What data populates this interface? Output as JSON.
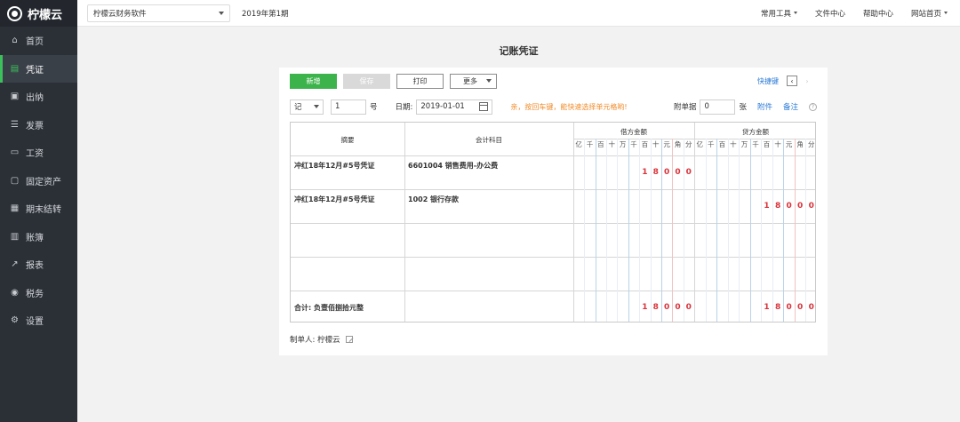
{
  "brand": {
    "name": "柠檬云"
  },
  "sidebar": {
    "items": [
      {
        "label": "首页",
        "icon": "⌂"
      },
      {
        "label": "凭证",
        "icon": "▤"
      },
      {
        "label": "出纳",
        "icon": "▣"
      },
      {
        "label": "发票",
        "icon": "☰"
      },
      {
        "label": "工资",
        "icon": "▭"
      },
      {
        "label": "固定资产",
        "icon": "▢"
      },
      {
        "label": "期末结转",
        "icon": "▦"
      },
      {
        "label": "账簿",
        "icon": "▥"
      },
      {
        "label": "报表",
        "icon": "↗"
      },
      {
        "label": "税务",
        "icon": "◉"
      },
      {
        "label": "设置",
        "icon": "⚙"
      }
    ],
    "active_index": 1
  },
  "topbar": {
    "company": "柠檬云财务软件",
    "period": "2019年第1期",
    "tools": "常用工具",
    "files": "文件中心",
    "help": "帮助中心",
    "site": "网站首页"
  },
  "page": {
    "title": "记账凭证"
  },
  "toolbar": {
    "new": "新增",
    "save": "保存",
    "print": "打印",
    "more": "更多",
    "shortcut": "快捷键",
    "prev": "‹",
    "next": "›"
  },
  "meta": {
    "word": "记",
    "number": "1",
    "hao": "号",
    "date_label": "日期:",
    "date": "2019-01-01",
    "hint": "亲，按回车键，能快速选择单元格哟!",
    "attach_label": "附单据",
    "attach_count": "0",
    "zhang": "张",
    "attachment": "附件",
    "note": "备注",
    "help": "?"
  },
  "table": {
    "summary_header": "摘要",
    "account_header": "会计科目",
    "debit_header": "借方金额",
    "credit_header": "贷方金额",
    "digit_units": [
      "亿",
      "千",
      "百",
      "十",
      "万",
      "千",
      "百",
      "十",
      "元",
      "角",
      "分"
    ],
    "rows": [
      {
        "summary": "冲红18年12月#5号凭证",
        "account": "6601004 销售费用-办公费",
        "debit": [
          "1",
          "8",
          "0",
          "0",
          "0"
        ],
        "credit": []
      },
      {
        "summary": "冲红18年12月#5号凭证",
        "account": "1002 银行存款",
        "debit": [],
        "credit": [
          "1",
          "8",
          "0",
          "0",
          "0"
        ]
      },
      {
        "summary": "",
        "account": "",
        "debit": [],
        "credit": []
      },
      {
        "summary": "",
        "account": "",
        "debit": [],
        "credit": []
      }
    ],
    "total_label": "合计: 负壹佰捌拾元整",
    "total_debit": [
      "1",
      "8",
      "0",
      "0",
      "0"
    ],
    "total_credit": [
      "1",
      "8",
      "0",
      "0",
      "0"
    ]
  },
  "footer": {
    "maker_label": "制单人:",
    "maker": "柠檬云"
  },
  "colors": {
    "brand_green": "#3cb44b",
    "sidebar_bg": "#2b3037",
    "amount_red": "#d9323a",
    "link_blue": "#2a7ad6",
    "hint_orange": "#f08c2b"
  }
}
